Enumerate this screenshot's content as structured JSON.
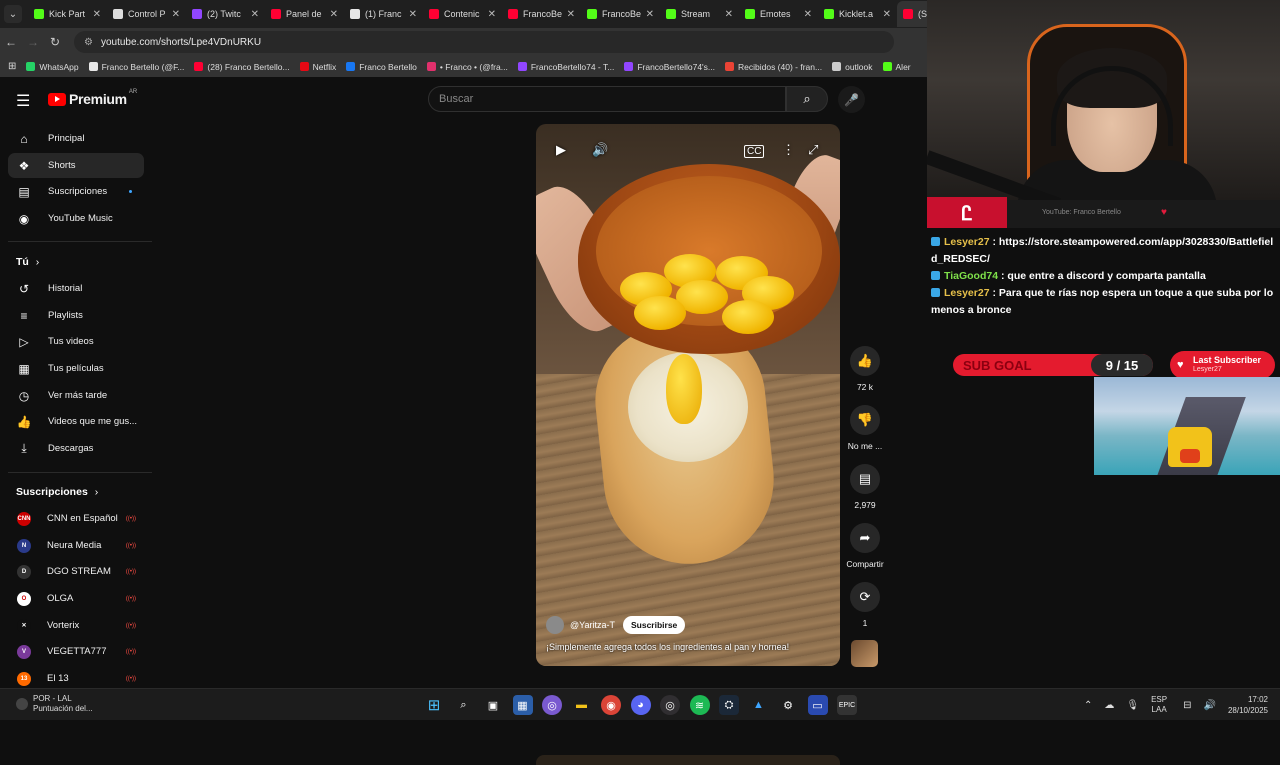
{
  "browser": {
    "tabs": [
      {
        "title": "Kick Part",
        "color": "#53fc18"
      },
      {
        "title": "Control P",
        "color": "#dddddd"
      },
      {
        "title": "(2) Twitc",
        "color": "#9146ff"
      },
      {
        "title": "Panel de",
        "color": "#ff0033"
      },
      {
        "title": "(1) Franc",
        "color": "#e7e7e7"
      },
      {
        "title": "Contenic",
        "color": "#ff0033"
      },
      {
        "title": "FrancoBe",
        "color": "#ff0033"
      },
      {
        "title": "FrancoBe",
        "color": "#53fc18"
      },
      {
        "title": "Stream",
        "color": "#53fc18"
      },
      {
        "title": "Emotes",
        "color": "#53fc18"
      },
      {
        "title": "Kicklet.a",
        "color": "#53fc18"
      },
      {
        "title": "(S",
        "color": "#ff0033"
      }
    ],
    "url": "youtube.com/shorts/Lpe4VDnURKU",
    "bookmarks": [
      {
        "label": "WhatsApp",
        "color": "#25d366"
      },
      {
        "label": "Franco Bertello (@F...",
        "color": "#e7e7e7"
      },
      {
        "label": "(28) Franco Bertello...",
        "color": "#ff0033"
      },
      {
        "label": "Netflix",
        "color": "#e50914"
      },
      {
        "label": "Franco Bertello",
        "color": "#1877f2"
      },
      {
        "label": "• Franco • (@fra...",
        "color": "#e1306c"
      },
      {
        "label": "FrancoBertello74 - T...",
        "color": "#9146ff"
      },
      {
        "label": "FrancoBertello74's...",
        "color": "#9146ff"
      },
      {
        "label": "Recibidos (40) - fran...",
        "color": "#ea4335"
      },
      {
        "label": "outlook",
        "color": "#cccccc"
      },
      {
        "label": "Aler",
        "color": "#53fc18"
      }
    ]
  },
  "youtube": {
    "logo": "Premium",
    "country": "AR",
    "search_placeholder": "Buscar",
    "nav": [
      {
        "label": "Principal",
        "icon": "home-icon",
        "glyph": "⌂"
      },
      {
        "label": "Shorts",
        "icon": "shorts-icon",
        "glyph": "❖"
      },
      {
        "label": "Suscripciones",
        "icon": "subscriptions-icon",
        "glyph": "▤"
      },
      {
        "label": "YouTube Music",
        "icon": "music-icon",
        "glyph": "◉"
      }
    ],
    "you_section": "Tú",
    "you_items": [
      {
        "label": "Historial",
        "icon": "history-icon",
        "glyph": "↺"
      },
      {
        "label": "Playlists",
        "icon": "playlist-icon",
        "glyph": "≡"
      },
      {
        "label": "Tus videos",
        "icon": "your-videos-icon",
        "glyph": "▷"
      },
      {
        "label": "Tus películas",
        "icon": "movies-icon",
        "glyph": "▦"
      },
      {
        "label": "Ver más tarde",
        "icon": "watch-later-icon",
        "glyph": "◷"
      },
      {
        "label": "Videos que me gus...",
        "icon": "liked-icon",
        "glyph": "👍"
      },
      {
        "label": "Descargas",
        "icon": "download-icon",
        "glyph": "⤓"
      }
    ],
    "subs_section": "Suscripciones",
    "subscriptions": [
      {
        "label": "CNN en Español",
        "abbr": "CNN",
        "color": "#cc0000"
      },
      {
        "label": "Neura Media",
        "abbr": "N",
        "color": "#2a3a8a"
      },
      {
        "label": "DGO STREAM",
        "abbr": "D",
        "color": "#333333"
      },
      {
        "label": "OLGA",
        "abbr": "O",
        "color": "#ffffff"
      },
      {
        "label": "Vorterix",
        "abbr": "✕",
        "color": "#0f0f0f"
      },
      {
        "label": "VEGETTA777",
        "abbr": "V",
        "color": "#7a3a9a"
      },
      {
        "label": "El 13",
        "abbr": "13",
        "color": "#ff6a00"
      }
    ],
    "short": {
      "channel": "@Yaritza-T",
      "subscribe_label": "Suscribirse",
      "description": "¡Simplemente agrega todos los ingredientes al pan y hornea!",
      "likes": "72 k",
      "dislike_label": "No me ...",
      "comments": "2,979",
      "share_label": "Compartir",
      "remix_count": "1"
    }
  },
  "stream": {
    "overlay_text": "YouTube: Franco Bertello",
    "chat": [
      {
        "user": "Lesyer27",
        "message": "https://store.steampowered.com/app/3028330/Battlefield_REDSEC/"
      },
      {
        "user": "TiaGood74",
        "message": "que entre a discord y comparta pantalla"
      },
      {
        "user": "Lesyer27",
        "message": "Para que te rías nop espera un toque a que suba por lo menos a bronce"
      }
    ],
    "sub_goal_label": "SUB GOAL",
    "sub_goal_value": "9 / 15",
    "last_sub_label": "Last Subscriber",
    "last_sub_user": "Lesyer27"
  },
  "taskbar": {
    "weather_title": "POR - LAL",
    "weather_sub": "Puntuación del...",
    "lang_1": "ESP",
    "lang_2": "LAA",
    "time": "17:02",
    "date": "28/10/2025"
  }
}
